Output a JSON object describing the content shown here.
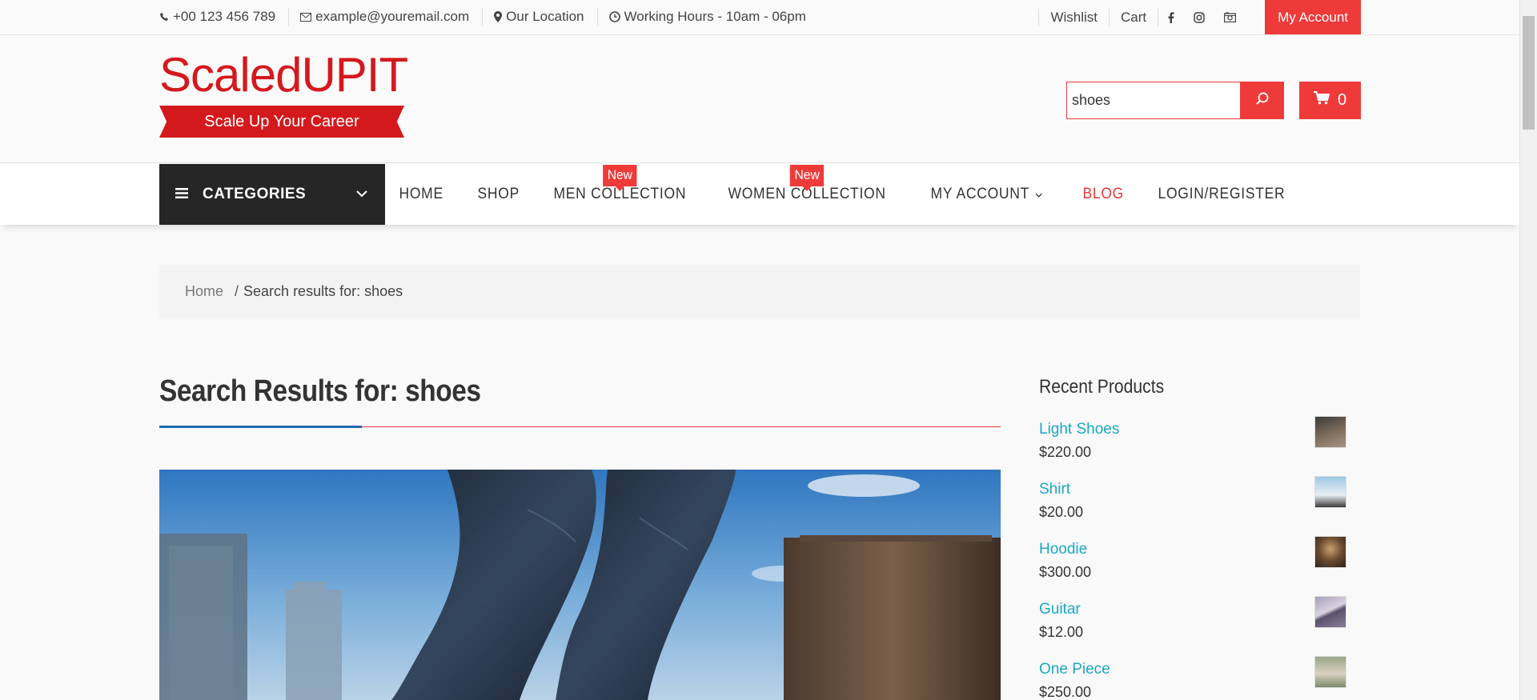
{
  "topbar": {
    "phone": "+00 123 456 789",
    "email": "example@youremail.com",
    "location": "Our Location",
    "hours": "Working Hours - 10am - 06pm",
    "wishlist": "Wishlist",
    "cart": "Cart",
    "account": "My Account"
  },
  "header": {
    "brand": "ScaledUPIT",
    "tagline": "Scale Up Your Career",
    "search_value": "shoes",
    "cart_count": "0"
  },
  "nav": {
    "categories": "CATEGORIES",
    "items": [
      {
        "label": "HOME"
      },
      {
        "label": "SHOP"
      },
      {
        "label": "MEN COLLECTION",
        "badge": "New"
      },
      {
        "label": "WOMEN COLLECTION",
        "badge": "New"
      },
      {
        "label": "MY ACCOUNT"
      },
      {
        "label": "BLOG"
      },
      {
        "label": "LOGIN/REGISTER"
      }
    ]
  },
  "breadcrumb": {
    "home": "Home",
    "separator": "/",
    "current": "Search results for: shoes"
  },
  "main": {
    "title": "Search Results for: shoes"
  },
  "sidebar": {
    "title": "Recent Products",
    "products": [
      {
        "name": "Light Shoes",
        "price": "$220.00",
        "thumb_color": "#7a6a5a"
      },
      {
        "name": "Shirt",
        "price": "$20.00",
        "thumb_color": "#a8c4d8"
      },
      {
        "name": "Hoodie",
        "price": "$300.00",
        "thumb_color": "#6b4a30"
      },
      {
        "name": "Guitar",
        "price": "$12.00",
        "thumb_color": "#8a7f9a"
      },
      {
        "name": "One Piece",
        "price": "$250.00",
        "thumb_color": "#9aa585"
      }
    ]
  },
  "colors": {
    "accent": "#ef3a3a",
    "brand": "#d4191d",
    "link": "#1ca7c6",
    "underline_blue": "#1a6ab3"
  }
}
